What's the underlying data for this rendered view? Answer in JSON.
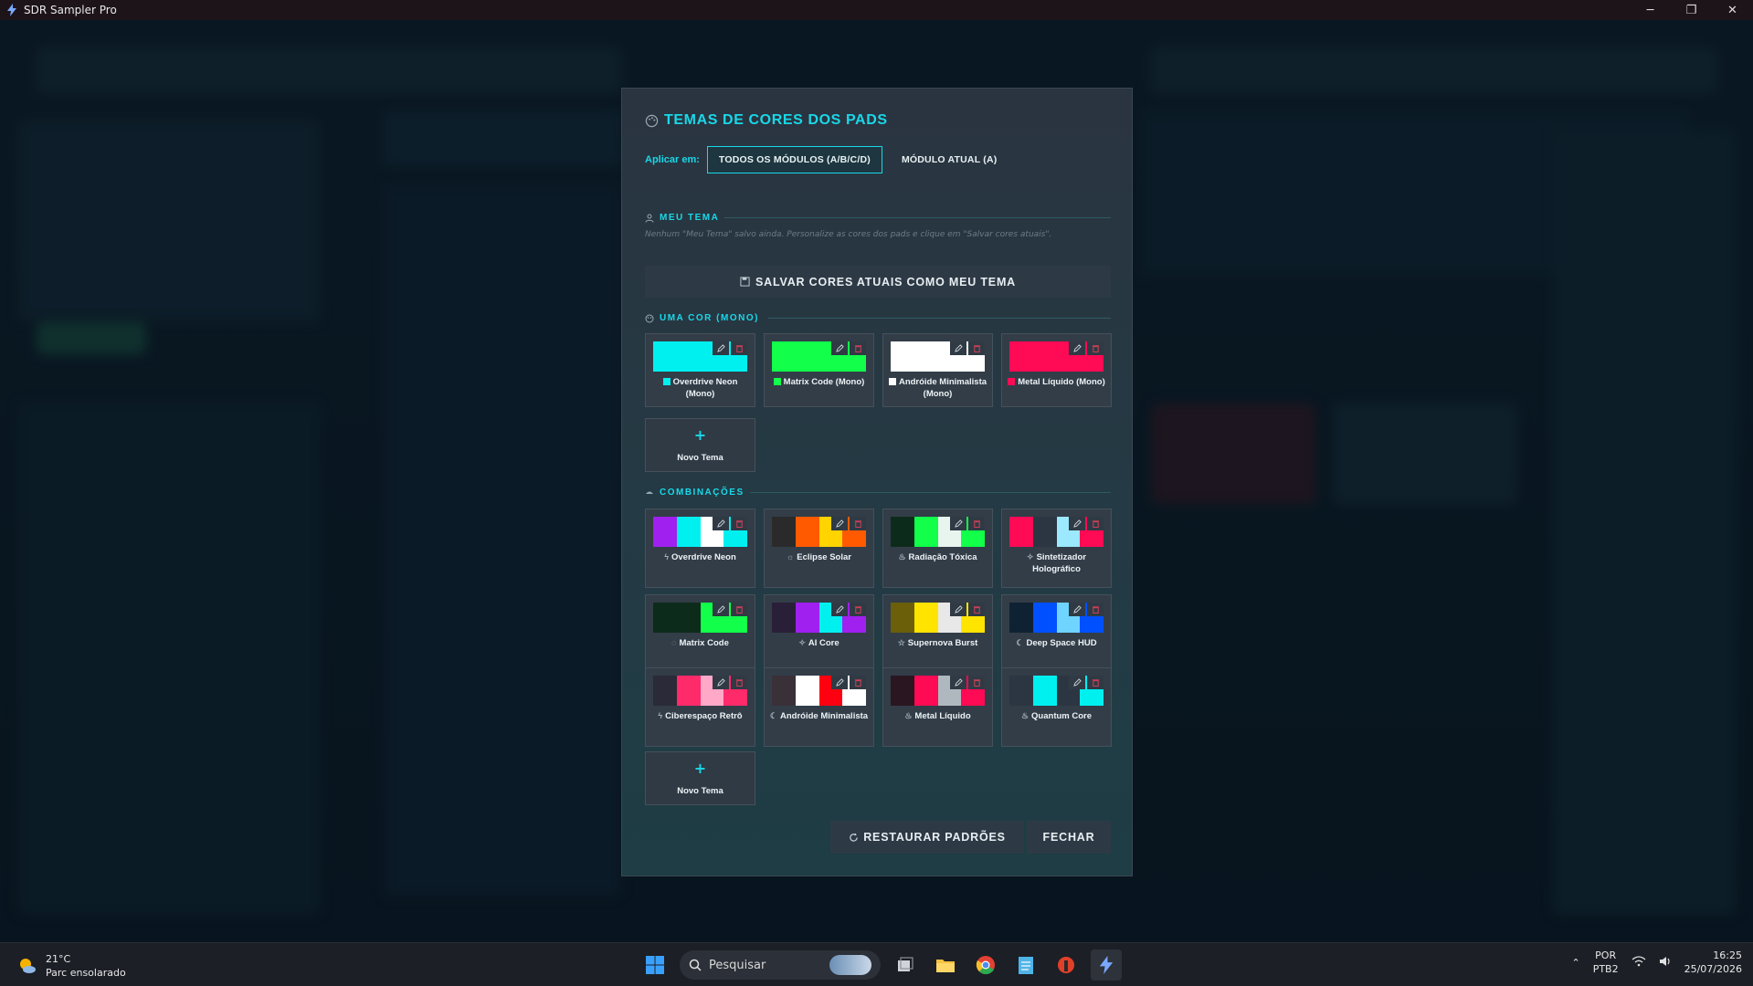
{
  "window": {
    "title": "SDR Sampler Pro",
    "minimize_glyph": "─",
    "maximize_glyph": "❐",
    "close_glyph": "✕"
  },
  "modal": {
    "title": "TEMAS DE CORES DOS PADS",
    "apply_label": "Aplicar em:",
    "scope_all": "TODOS OS MÓDULOS (A/B/C/D)",
    "scope_current": "MÓDULO ATUAL (A)",
    "my_theme": {
      "heading": "MEU TEMA",
      "note": "Nenhum \"Meu Tema\" salvo ainda. Personalize as cores dos pads e clique em \"Salvar cores atuais\".",
      "save_label": "SALVAR CORES ATUAIS COMO MEU TEMA"
    },
    "mono": {
      "heading": "UMA COR (MONO)",
      "themes": [
        {
          "name": "Overdrive Neon (Mono)",
          "colors": [
            "#00f0f0"
          ]
        },
        {
          "name": "Matrix Code (Mono)",
          "colors": [
            "#12ff4a"
          ]
        },
        {
          "name": "Andróide Minimalista (Mono)",
          "colors": [
            "#ffffff"
          ]
        },
        {
          "name": "Metal Líquido (Mono)",
          "colors": [
            "#ff0a54"
          ]
        }
      ],
      "new_label": "Novo Tema"
    },
    "combos": {
      "heading": "COMBINAÇÕES",
      "themes": [
        {
          "name": "Overdrive Neon",
          "icon": "bolt",
          "colors": [
            "#a020f0",
            "#00f0f0",
            "#ffffff",
            "#00f0f0"
          ]
        },
        {
          "name": "Eclipse Solar",
          "icon": "sun",
          "colors": [
            "#2a2a2a",
            "#ff5a00",
            "#ffd400",
            "#ff5a00"
          ]
        },
        {
          "name": "Radiação Tóxica",
          "icon": "flame",
          "colors": [
            "#0d2b1a",
            "#12ff4a",
            "#e8f5ee",
            "#12ff4a"
          ]
        },
        {
          "name": "Sintetizador Holográfico",
          "icon": "sparkle",
          "colors": [
            "#ff0a54",
            "#2c3642",
            "#9be8ff",
            "#ff0a54"
          ]
        },
        {
          "name": "Matrix Code",
          "icon": "circle",
          "colors": [
            "#0d2b1a",
            "#0d2b1a",
            "#12ff4a",
            "#12ff4a"
          ]
        },
        {
          "name": "AI Core",
          "icon": "sparkle",
          "colors": [
            "#2a1f38",
            "#a020f0",
            "#00f0f0",
            "#a020f0"
          ]
        },
        {
          "name": "Supernova Burst",
          "icon": "star",
          "colors": [
            "#6b5f0a",
            "#ffe400",
            "#e8e8e8",
            "#ffe400"
          ]
        },
        {
          "name": "Deep Space HUD",
          "icon": "moon",
          "colors": [
            "#0f2233",
            "#0050ff",
            "#6fd4ff",
            "#0050ff"
          ]
        },
        {
          "name": "Ciberespaço Retrô",
          "icon": "bolt",
          "colors": [
            "#2a2a38",
            "#ff2a6a",
            "#ffa8c8",
            "#ff2a6a"
          ]
        },
        {
          "name": "Andróide Minimalista",
          "icon": "moon",
          "colors": [
            "#3a3038",
            "#ffffff",
            "#ff0010",
            "#ffffff"
          ]
        },
        {
          "name": "Metal Líquido",
          "icon": "flame",
          "colors": [
            "#2a1620",
            "#ff0a54",
            "#b0b8bf",
            "#ff0a54"
          ]
        },
        {
          "name": "Quantum Core",
          "icon": "flame",
          "colors": [
            "#2c3642",
            "#00f0f0",
            "#2c3642",
            "#00f0f0"
          ]
        }
      ],
      "new_label": "Novo Tema"
    },
    "restore_label": "RESTAURAR PADRÕES",
    "close_label": "FECHAR"
  },
  "taskbar": {
    "temperature": "21°C",
    "weather": "Parc ensolarado",
    "search_placeholder": "Pesquisar",
    "lang_top": "POR",
    "lang_bottom": "PTB2",
    "time": "16:25",
    "date": "25/07/2026"
  },
  "colors": {
    "accent": "#19d8e8"
  }
}
